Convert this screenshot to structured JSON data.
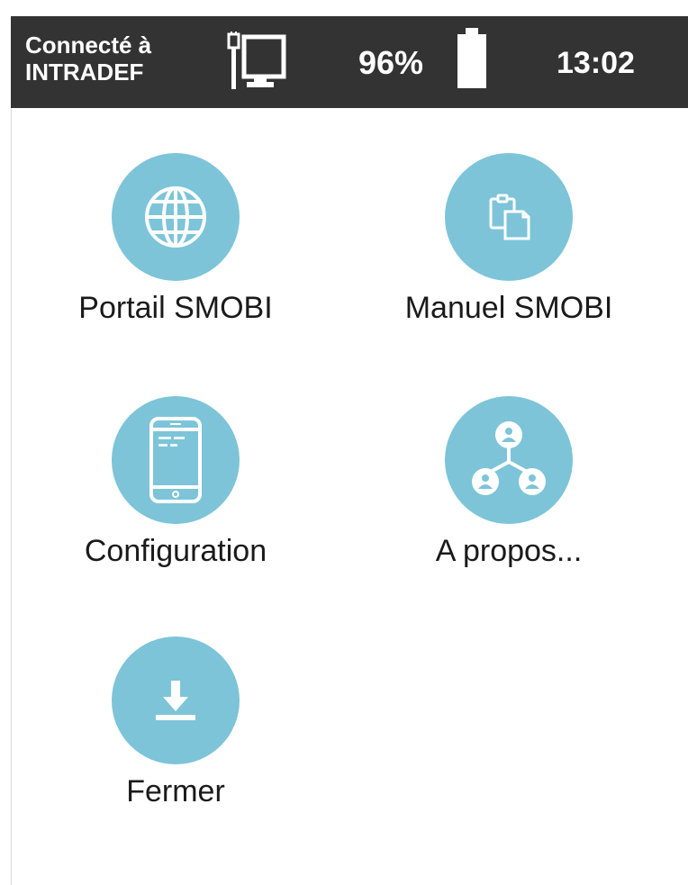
{
  "status_bar": {
    "connection_line1": "Connecté à",
    "connection_line2": "INTRADEF",
    "network_icon": "network-computer-icon",
    "battery_percent": "96%",
    "battery_icon": "battery-icon",
    "time": "13:02"
  },
  "menu": [
    {
      "label": "Portail SMOBI",
      "icon": "globe-icon"
    },
    {
      "label": "Manuel SMOBI",
      "icon": "clipboard-copy-icon"
    },
    {
      "label": "Configuration",
      "icon": "smartphone-icon"
    },
    {
      "label": "A propos...",
      "icon": "people-network-icon"
    },
    {
      "label": "Fermer",
      "icon": "download-icon"
    }
  ],
  "colors": {
    "status_bar_bg": "#333333",
    "icon_circle": "#7dc4d9",
    "icon_glyph": "#ffffff",
    "label_text": "#1a1a1a"
  }
}
